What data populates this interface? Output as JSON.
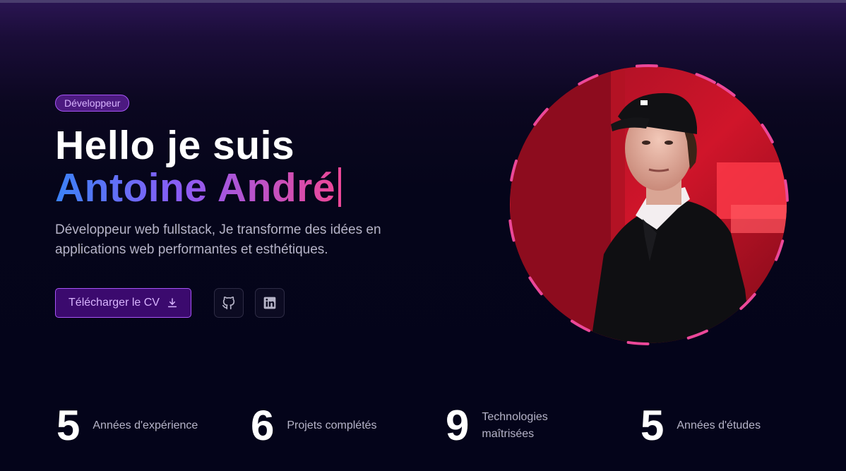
{
  "hero": {
    "badge": "Développeur",
    "title_line1": "Hello je suis",
    "title_name": "Antoine André",
    "description_line1": "Développeur web fullstack, Je transforme des idées en",
    "description_line2": "applications web performantes et esthétiques.",
    "cv_button_label": "Télécharger le CV",
    "social": [
      "github-icon",
      "linkedin-icon"
    ]
  },
  "stats": [
    {
      "value": "5",
      "label_line1": "Années d'expérience",
      "label_line2": ""
    },
    {
      "value": "6",
      "label_line1": "Projets complétés",
      "label_line2": ""
    },
    {
      "value": "9",
      "label_line1": "Technologies",
      "label_line2": "maîtrisées"
    },
    {
      "value": "5",
      "label_line1": "Années d'études",
      "label_line2": ""
    }
  ],
  "colors": {
    "accent_purple": "#a855f7",
    "gradient_start": "#3b82f6",
    "gradient_mid": "#8b5cf6",
    "gradient_end": "#ec4899",
    "ring_pink": "#ec4899",
    "background": "#04041a"
  }
}
